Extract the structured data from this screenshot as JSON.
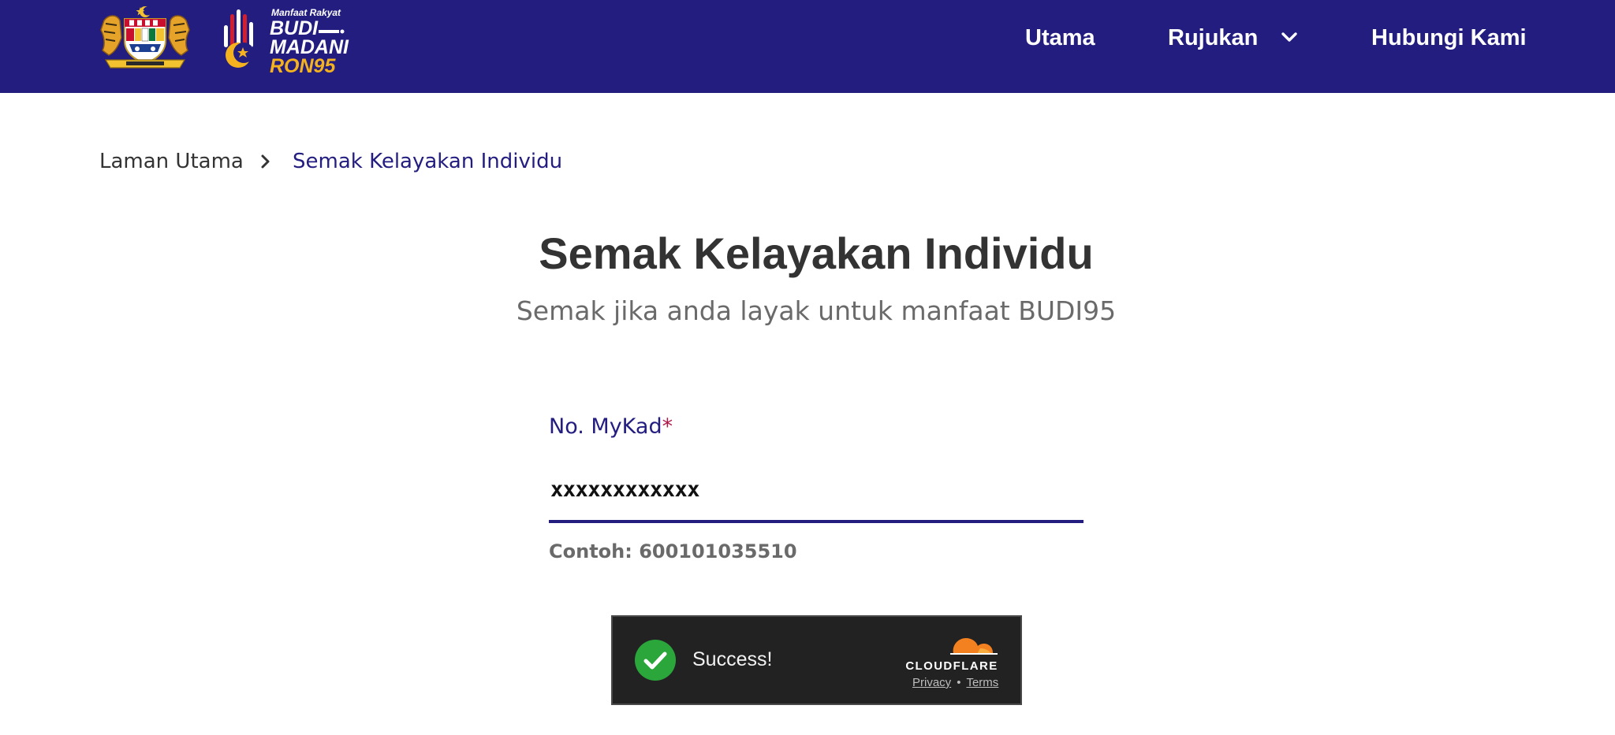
{
  "header": {
    "crest_alt": "Jata Negara Malaysia",
    "logo": {
      "line1": "Manfaat Rakyat",
      "line2": "BUDI",
      "line3": "MADANI",
      "line4": "RON95"
    },
    "nav": {
      "home": "Utama",
      "references": "Rujukan",
      "contact": "Hubungi Kami"
    },
    "colors": {
      "background": "#231d80",
      "logo_accent": "#f4b21e"
    }
  },
  "breadcrumb": {
    "home": "Laman Utama",
    "current": "Semak Kelayakan Individu"
  },
  "main": {
    "title": "Semak Kelayakan Individu",
    "subtitle": "Semak jika anda layak untuk manfaat BUDI95"
  },
  "form": {
    "mykad_label": "No. MyKad",
    "required_mark": "*",
    "mykad_value": "xxxxxxxxxxxx",
    "hint": "Contoh: 600101035510"
  },
  "captcha": {
    "status": "Success!",
    "provider": "CLOUDFLARE",
    "privacy": "Privacy",
    "separator": "•",
    "terms": "Terms",
    "colors": {
      "check": "#2aa63b",
      "cloud": "#f48120"
    }
  }
}
